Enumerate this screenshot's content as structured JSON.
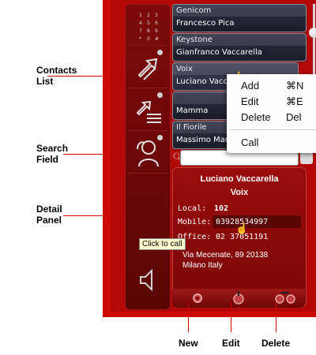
{
  "annotations": {
    "contacts_list": "Contacts\nList",
    "search_field": "Search\nField",
    "detail_panel": "Detail\nPanel",
    "new": "New",
    "edit": "Edit",
    "delete": "Delete"
  },
  "contacts": [
    {
      "company": "Genicom",
      "name": "Francesco Pica"
    },
    {
      "company": "Keystone",
      "name": "Gianfranco Vaccarella"
    },
    {
      "company": "Voix",
      "name": "Luciano Vaccarella"
    },
    {
      "company": "",
      "name": "Mamma"
    },
    {
      "company": "Il Fiorile",
      "name": "Massimo Martinelli"
    }
  ],
  "context_menu": {
    "items": [
      {
        "label": "Add",
        "shortcut": "⌘N"
      },
      {
        "label": "Edit",
        "shortcut": "⌘E"
      },
      {
        "label": "Delete",
        "shortcut": "Del"
      },
      {
        "label": "Call",
        "shortcut": ""
      }
    ]
  },
  "detail": {
    "name": "Luciano Vaccarella",
    "company": "Voix",
    "local_label": "Local:",
    "local_value": "102",
    "mobile_label": "Mobile:",
    "mobile_value": "03928534997",
    "office_label": "Office:",
    "office_value": "02 37051191",
    "address_line1": "Via Mecenate, 89 20138",
    "address_line2": "Milano Italy",
    "tooltip": "Click to call"
  },
  "icons": {
    "keypad": "keypad-icon",
    "transfer": "transfer-icon",
    "list": "list-icon",
    "contact": "contact-icon",
    "speaker": "speaker-icon"
  },
  "colors": {
    "app_red": "#cc0a0a",
    "annotation_line": "#d40000",
    "card_dark": "#222433"
  }
}
